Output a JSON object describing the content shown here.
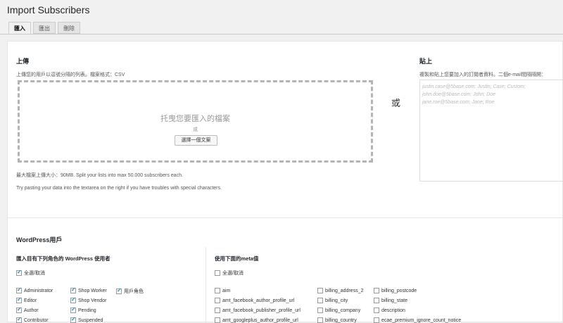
{
  "page": {
    "title": "Import Subscribers"
  },
  "tabs": [
    "匯入",
    "匯出",
    "刪除"
  ],
  "upload": {
    "heading": "上傳",
    "desc": "上傳您的用戶以逗號分隔的列表。檔案格式：CSV",
    "drop_text": "托曳您要匯入的檔案",
    "or_small": "或",
    "choose_button": "選擇一個文案",
    "max_size": "最大檔案上傳大小：90MB. Split your lists into max 50.000 subscribers each.",
    "tip": "Try pasting your data into the textarea on the right if you have troubles with special characters."
  },
  "or_big": "或",
  "paste": {
    "heading": "貼上",
    "desc": "複製和貼上您要加入的訂閱者資料。二個e-mail間隔隔開：",
    "placeholder_lines": [
      "justin.case@5base.com; Justin; Case; Custom;",
      "john.doe@5base.com; John; Doe",
      "jane.roe@5base.com; Jane; Roe"
    ]
  },
  "wp": {
    "heading": "WordPress用戶",
    "roles_heading": "匯入目有下列角色的 WordPress 使用者",
    "select_all": "全選/取消",
    "roles": {
      "col1": [
        {
          "label": "Administrator",
          "checked": true
        },
        {
          "label": "Editor",
          "checked": true
        },
        {
          "label": "Author",
          "checked": true
        },
        {
          "label": "Contributor",
          "checked": true
        }
      ],
      "col2": [
        {
          "label": "Shop Worker",
          "checked": true
        },
        {
          "label": "Shop Vendor",
          "checked": true
        },
        {
          "label": "Pending",
          "checked": true
        },
        {
          "label": "Suspended",
          "checked": true
        }
      ],
      "col3": [
        {
          "label": "用戶角色",
          "checked": true
        }
      ]
    },
    "meta_heading": "使用下面的meta值",
    "meta_select_all": "全選/取消",
    "meta": {
      "col1": [
        "aim",
        "amt_facebook_author_profile_url",
        "amt_facebook_publisher_profile_url",
        "amt_googleplus_author_profile_url"
      ],
      "col2": [
        "billing_address_2",
        "billing_city",
        "billing_company",
        "billing_country"
      ],
      "col3": [
        "billing_postcode",
        "billing_state",
        "description",
        "ecae_premium_ignore_count_notice"
      ]
    }
  }
}
